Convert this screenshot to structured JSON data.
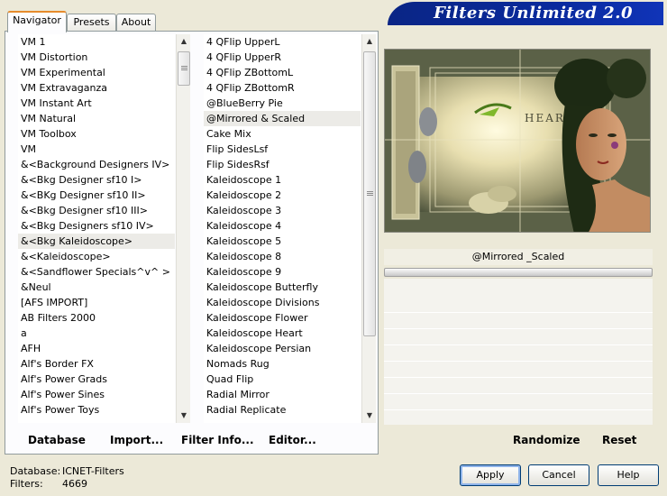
{
  "title": "Filters Unlimited 2.0",
  "tabs": [
    {
      "label": "Navigator",
      "active": true
    },
    {
      "label": "Presets",
      "active": false
    },
    {
      "label": "About",
      "active": false
    }
  ],
  "categories": {
    "selected_index": 13,
    "items": [
      "VM 1",
      "VM Distortion",
      "VM Experimental",
      "VM Extravaganza",
      "VM Instant Art",
      "VM Natural",
      "VM Toolbox",
      "VM",
      "&<Background Designers IV>",
      "&<Bkg Designer sf10 I>",
      "&<BKg Designer sf10 II>",
      "&<Bkg Designer sf10 III>",
      "&<Bkg Designers sf10 IV>",
      "&<Bkg Kaleidoscope>",
      "&<Kaleidoscope>",
      "&<Sandflower Specials^v^ >",
      "&Neul",
      "[AFS IMPORT]",
      "AB Filters 2000",
      "a",
      "AFH",
      "Alf's Border FX",
      "Alf's Power Grads",
      "Alf's Power Sines",
      "Alf's Power Toys"
    ]
  },
  "filters": {
    "selected_index": 5,
    "items": [
      "4 QFlip UpperL",
      "4 QFlip UpperR",
      "4 QFlip ZBottomL",
      "4 QFlip ZBottomR",
      "@BlueBerry Pie",
      "@Mirrored & Scaled",
      "Cake Mix",
      "Flip SidesLsf",
      "Flip SidesRsf",
      "Kaleidoscope 1",
      "Kaleidoscope 2",
      "Kaleidoscope 3",
      "Kaleidoscope 4",
      "Kaleidoscope 5",
      "Kaleidoscope 8",
      "Kaleidoscope 9",
      "Kaleidoscope Butterfly",
      "Kaleidoscope Divisions",
      "Kaleidoscope Flower",
      "Kaleidoscope Heart",
      "Kaleidoscope Persian",
      "Nomads Rug",
      "Quad Flip",
      "Radial Mirror",
      "Radial Replicate"
    ]
  },
  "list_buttons": {
    "database": "Database",
    "import": "Import...",
    "filter_info": "Filter Info...",
    "editor": "Editor..."
  },
  "preview": {
    "filter_name": "@Mirrored _Scaled",
    "image_text": "HEART",
    "progress": 1.0
  },
  "randomize": "Randomize",
  "reset": "Reset",
  "status": {
    "database_label": "Database:",
    "database_value": "ICNET-Filters",
    "filters_label": "Filters:",
    "filters_value": "4669"
  },
  "buttons": {
    "apply": "Apply",
    "cancel": "Cancel",
    "help": "Help"
  },
  "colors": {
    "banner": "#0a2a9d",
    "selection": "#ecebe7"
  }
}
